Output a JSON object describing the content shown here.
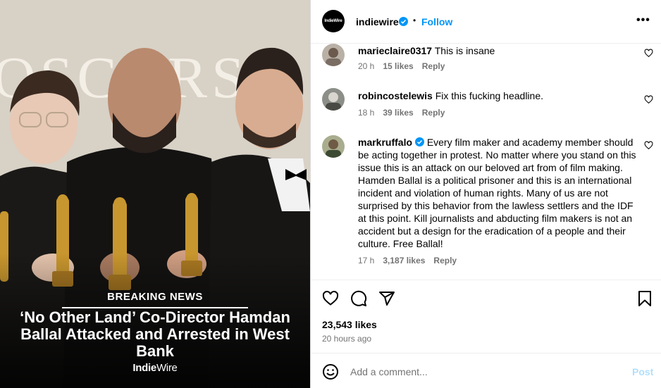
{
  "post": {
    "account": "indiewire",
    "avatar_text": "IndieWire",
    "dot": "•",
    "follow_label": "Follow",
    "more_label": "•••"
  },
  "image": {
    "breaking": "BREAKING NEWS",
    "headline": "‘No Other Land’ Co-Director Hamdan Ballal Attacked and Arrested in West Bank",
    "logo_indie": "Indie",
    "logo_wire": "Wire",
    "backdrop_text": "OSCARS"
  },
  "comments": [
    {
      "user": "marieclaire0317",
      "text": "This is insane",
      "time": "20 h",
      "likes": "15 likes",
      "reply": "Reply"
    },
    {
      "user": "robincostelewis",
      "text": "Fix this fucking headline.",
      "time": "18 h",
      "likes": "39 likes",
      "reply": "Reply"
    },
    {
      "user": "markruffalo",
      "text": "Every film maker and academy member should be acting together in protest. No matter where you stand on this issue this is an attack on our beloved art from of film making. Hamden Ballal is a political prisoner and this is an international incident and violation of human rights. Many of us are not surprised by this behavior from the lawless settlers and the IDF at this point. Kill journalists and abducting film makers is not an accident but a design for the eradication of a people and their culture. Free Ballal!",
      "time": "17 h",
      "likes": "3,187 likes",
      "reply": "Reply"
    }
  ],
  "stats": {
    "likes": "23,543 likes",
    "time_ago": "20 hours ago"
  },
  "composer": {
    "placeholder": "Add a comment...",
    "post_label": "Post"
  },
  "colors": {
    "follow_blue": "#0095f6",
    "post_disabled": "#b2dffc",
    "meta_grey": "#737373"
  }
}
